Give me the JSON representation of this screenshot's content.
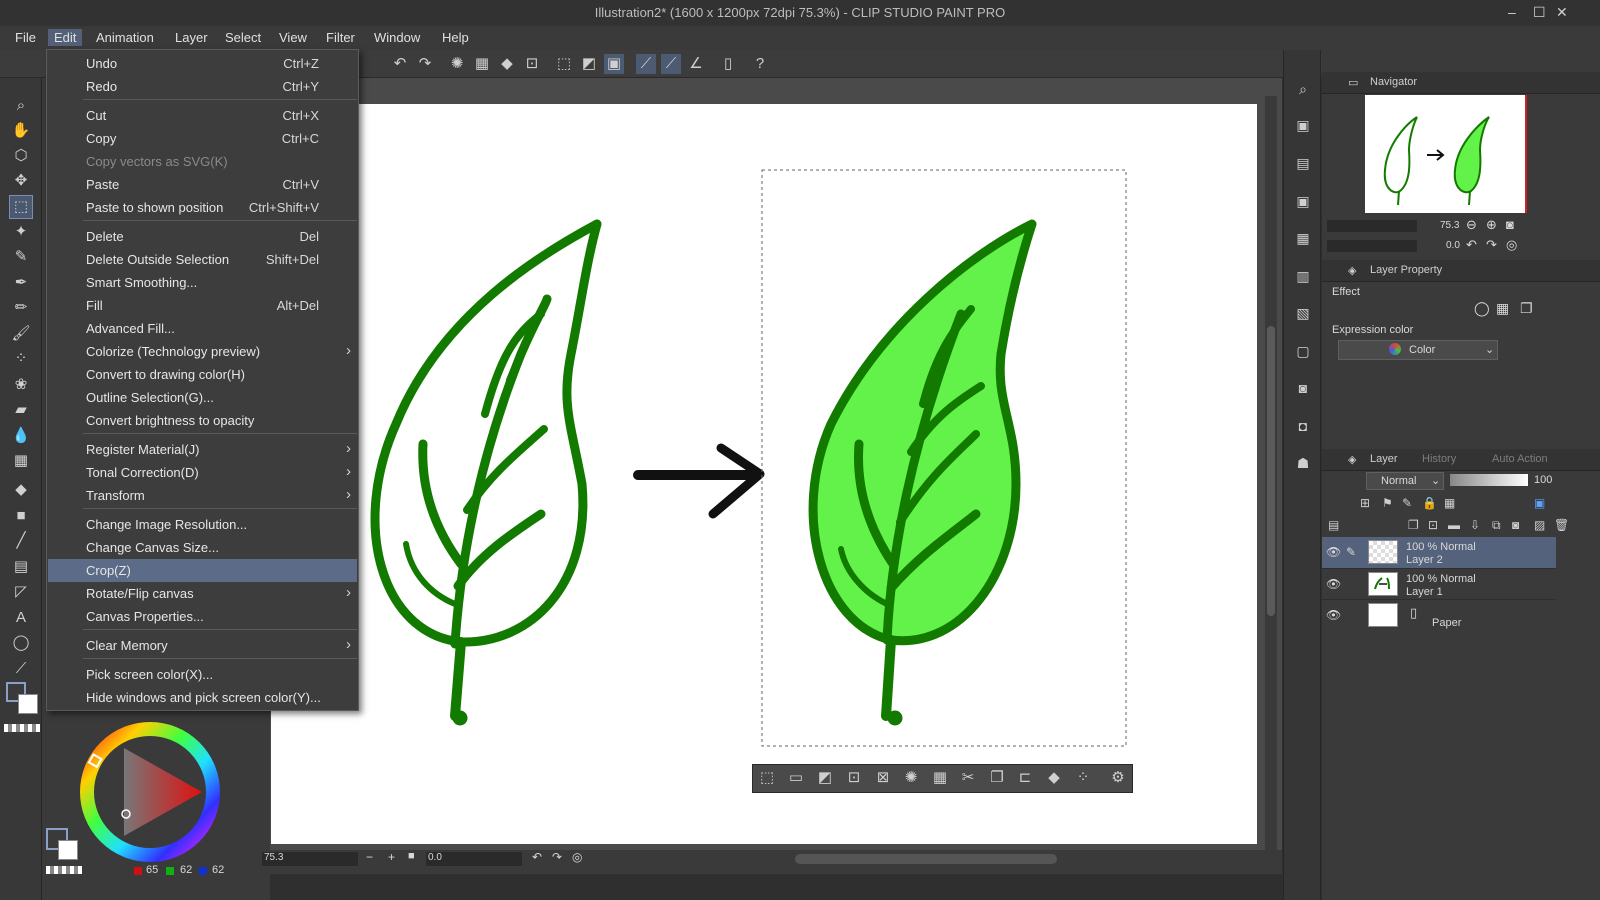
{
  "window": {
    "title": "Illustration2* (1600 x 1200px 72dpi 75.3%)  - CLIP STUDIO PAINT PRO",
    "controls": [
      "–",
      "☐",
      "✕"
    ]
  },
  "menubar": [
    "File",
    "Edit",
    "Animation",
    "Layer",
    "Select",
    "View",
    "Filter",
    "Window",
    "Help"
  ],
  "edit_menu": {
    "items": [
      {
        "label": "Undo",
        "shortcut": "Ctrl+Z"
      },
      {
        "label": "Redo",
        "shortcut": "Ctrl+Y"
      },
      {
        "label": "Cut",
        "shortcut": "Ctrl+X"
      },
      {
        "label": "Copy",
        "shortcut": "Ctrl+C"
      },
      {
        "label": "Copy vectors as SVG(K)",
        "shortcut": ""
      },
      {
        "label": "Paste",
        "shortcut": "Ctrl+V"
      },
      {
        "label": "Paste to shown position",
        "shortcut": "Ctrl+Shift+V"
      },
      {
        "label": "Delete",
        "shortcut": "Del"
      },
      {
        "label": "Delete Outside Selection",
        "shortcut": "Shift+Del"
      },
      {
        "label": "Smart Smoothing...",
        "shortcut": ""
      },
      {
        "label": "Fill",
        "shortcut": "Alt+Del"
      },
      {
        "label": "Advanced Fill...",
        "shortcut": ""
      },
      {
        "label": "Colorize (Technology preview)",
        "shortcut": ""
      },
      {
        "label": "Convert to drawing color(H)",
        "shortcut": ""
      },
      {
        "label": "Outline Selection(G)...",
        "shortcut": ""
      },
      {
        "label": "Convert brightness to opacity",
        "shortcut": ""
      },
      {
        "label": "Register Material(J)",
        "shortcut": ""
      },
      {
        "label": "Tonal Correction(D)",
        "shortcut": ""
      },
      {
        "label": "Transform",
        "shortcut": ""
      },
      {
        "label": "Change Image Resolution...",
        "shortcut": ""
      },
      {
        "label": "Change Canvas Size...",
        "shortcut": ""
      },
      {
        "label": "Crop(Z)",
        "shortcut": ""
      },
      {
        "label": "Rotate/Flip canvas",
        "shortcut": ""
      },
      {
        "label": "Canvas Properties...",
        "shortcut": ""
      },
      {
        "label": "Clear Memory",
        "shortcut": ""
      },
      {
        "label": "Pick screen color(X)...",
        "shortcut": ""
      },
      {
        "label": "Hide windows and pick screen color(Y)...",
        "shortcut": ""
      }
    ]
  },
  "navigator": {
    "tab": "Navigator",
    "zoom": "75.3",
    "rotation": "0.0"
  },
  "layer_property": {
    "tab": "Layer Property",
    "effect_label": "Effect",
    "expression_color_label": "Expression color",
    "expression_color_value": "Color"
  },
  "layer_panel": {
    "tabs": [
      "Layer",
      "History",
      "Auto Action"
    ],
    "blend_mode": "Normal",
    "opacity": "100",
    "layers": [
      {
        "mode": "100 % Normal",
        "name": "Layer 2"
      },
      {
        "mode": "100 % Normal",
        "name": "Layer 1"
      },
      {
        "mode": "",
        "name": "Paper"
      }
    ]
  },
  "color_wheel": {
    "r": "65",
    "g": "62",
    "b": "62"
  },
  "status": {
    "zoom": "75.3",
    "rotation": "0.0"
  },
  "colors": {
    "leaf_outline": "#137a00",
    "leaf_fill": "#62f24a",
    "menu_highlight": "#5b6b88",
    "active_menu": "#536078"
  }
}
